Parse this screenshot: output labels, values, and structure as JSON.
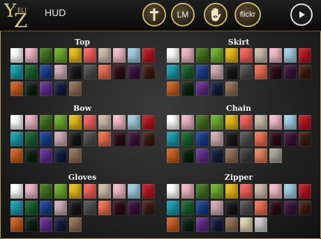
{
  "header": {
    "logo_y": "Y",
    "logo_z": "Z",
    "logo_mid": "ELI",
    "hud_label": "HUD",
    "buttons": [
      {
        "icon": "cross-icon",
        "label": ""
      },
      {
        "icon": "",
        "label": "LM"
      },
      {
        "icon": "hand-eye-icon",
        "label": ""
      },
      {
        "icon": "",
        "label": "flickr"
      },
      {
        "icon": "play-icon",
        "label": ""
      }
    ]
  },
  "sections": [
    {
      "title": "Top",
      "colors": [
        "#ffffff",
        "#eab1c0",
        "#3f6d1d",
        "#6aa62a",
        "#e3b815",
        "#ed5c56",
        "#c9b7a5",
        "#f1b8c4",
        "#9ecae0",
        "#b0141c",
        "#1696a6",
        "#165c2a",
        "#153b87",
        "#cba7b2",
        "#151515",
        "#4a4a4a",
        "#e66a4c",
        "#2a0a14",
        "#381038",
        "#3a1a12",
        "#c25a1e",
        "#0a1f0f",
        "#5e2a88",
        "#121a3a",
        "#8a6a52"
      ]
    },
    {
      "title": "Skirt",
      "colors": [
        "#ffffff",
        "#eab1c0",
        "#3f6d1d",
        "#6aa62a",
        "#e3b815",
        "#ed5c56",
        "#c9b7a5",
        "#f1b8c4",
        "#9ecae0",
        "#b0141c",
        "#1696a6",
        "#165c2a",
        "#153b87",
        "#cba7b2",
        "#151515",
        "#4a4a4a",
        "#e66a4c",
        "#2a0a14",
        "#381038",
        "#3a1a12",
        "#c25a1e",
        "#0a1f0f",
        "#5e2a88",
        "#121a3a",
        "#8a6a52"
      ]
    },
    {
      "title": "Bow",
      "colors": [
        "#ffffff",
        "#eab1c0",
        "#3f6d1d",
        "#6aa62a",
        "#e3b815",
        "#ed5c56",
        "#c9b7a5",
        "#f1b8c4",
        "#9ecae0",
        "#b0141c",
        "#1696a6",
        "#165c2a",
        "#153b87",
        "#cba7b2",
        "#151515",
        "#4a4a4a",
        "#e66a4c",
        "#2a0a14",
        "#381038",
        "#3a1a12",
        "#c25a1e",
        "#0a1f0f",
        "#5e2a88",
        "#121a3a",
        "#8a6a52"
      ]
    },
    {
      "title": "Chain",
      "colors": [
        "#ffffff",
        "#eab1c0",
        "#3f6d1d",
        "#6aa62a",
        "#e3b815",
        "#ed5c56",
        "#c9b7a5",
        "#f1b8c4",
        "#9ecae0",
        "#b0141c",
        "#1696a6",
        "#165c2a",
        "#153b87",
        "#cba7b2",
        "#151515",
        "#4a4a4a",
        "#e66a4c",
        "#2a0a14",
        "#381038",
        "#3a1a12",
        "#c25a1e",
        "#0a1f0f",
        "#5e2a88",
        "#121a3a",
        "#8a6a52",
        "#3a3a3a",
        "#e07a5a",
        "#a8a095"
      ]
    },
    {
      "title": "Gloves",
      "colors": [
        "#ffffff",
        "#eab1c0",
        "#3f6d1d",
        "#6aa62a",
        "#e3b815",
        "#ed5c56",
        "#c9b7a5",
        "#f1b8c4",
        "#9ecae0",
        "#b0141c",
        "#1696a6",
        "#165c2a",
        "#153b87",
        "#cba7b2",
        "#151515",
        "#4a4a4a",
        "#e66a4c",
        "#2a0a14",
        "#381038",
        "#3a1a12",
        "#c25a1e",
        "#0a1f0f",
        "#5e2a88",
        "#121a3a",
        "#8a6a52"
      ]
    },
    {
      "title": "Zipper",
      "colors": [
        "#ffffff",
        "#eab1c0",
        "#3f6d1d",
        "#6aa62a",
        "#e3b815",
        "#ed5c56",
        "#c9b7a5",
        "#f1b8c4",
        "#9ecae0",
        "#b0141c",
        "#1696a6",
        "#165c2a",
        "#153b87",
        "#cba7b2",
        "#151515",
        "#4a4a4a",
        "#e66a4c",
        "#2a0a14",
        "#381038",
        "#3a1a12",
        "#c25a1e",
        "#0a1f0f",
        "#5e2a88",
        "#121a3a",
        "#8a6a52",
        "#d8cfa8",
        "#c9c9c9"
      ]
    }
  ]
}
